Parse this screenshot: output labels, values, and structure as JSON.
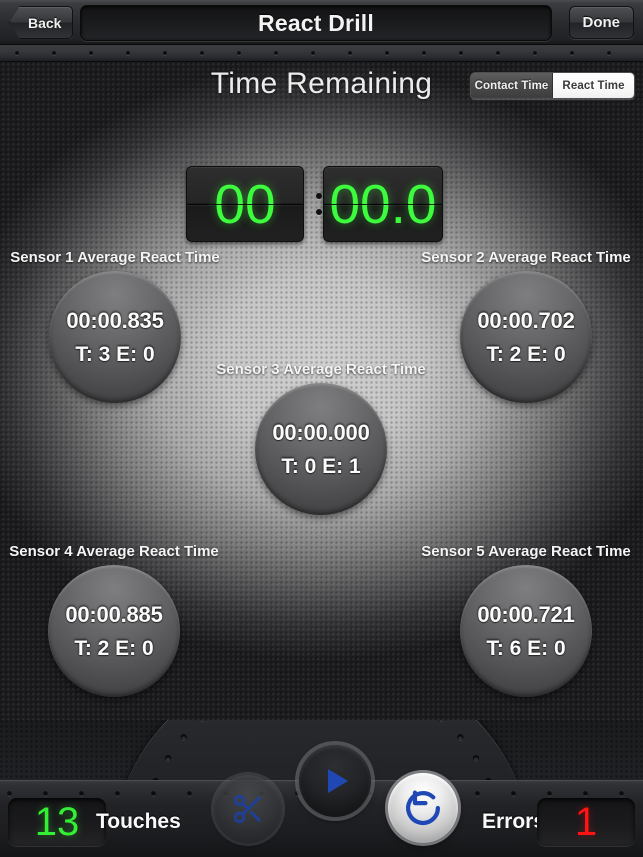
{
  "nav": {
    "back_label": "Back",
    "done_label": "Done",
    "title": "React Drill"
  },
  "header": {
    "time_remaining_label": "Time Remaining",
    "mode_toggle": {
      "options": [
        "Contact Time",
        "React Time"
      ],
      "selected": "React Time"
    }
  },
  "clock": {
    "minutes": "00",
    "seconds": "00.0",
    "separator": ":"
  },
  "sensors": [
    {
      "caption": "Sensor 1 Average React Time",
      "time": "00:00.835",
      "stats": "T: 3 E: 0",
      "touches": 3,
      "errors": 0
    },
    {
      "caption": "Sensor 2 Average React Time",
      "time": "00:00.702",
      "stats": "T: 2 E: 0",
      "touches": 2,
      "errors": 0
    },
    {
      "caption": "Sensor 3 Average React Time",
      "time": "00:00.000",
      "stats": "T: 0 E: 1",
      "touches": 0,
      "errors": 1
    },
    {
      "caption": "Sensor 4 Average React Time",
      "time": "00:00.885",
      "stats": "T: 2 E: 0",
      "touches": 2,
      "errors": 0
    },
    {
      "caption": "Sensor 5 Average React Time",
      "time": "00:00.721",
      "stats": "T: 6 E: 0",
      "touches": 6,
      "errors": 0
    }
  ],
  "toolbar": {
    "touches_count": "13",
    "touches_label": "Touches",
    "errors_label": "Errors",
    "errors_count": "1",
    "buttons": [
      {
        "icon": "scissors-icon",
        "state": "dimmed"
      },
      {
        "icon": "play-icon",
        "state": "normal"
      },
      {
        "icon": "reset-icon",
        "state": "highlighted"
      }
    ]
  },
  "colors": {
    "timer_green": "#3dfb3d",
    "touches_green": "#34ef34",
    "errors_red": "#ff1313",
    "icon_blue": "#1f48b4",
    "panel_light": "#cfcfcf",
    "panel_dark": "#1b1b1e"
  }
}
